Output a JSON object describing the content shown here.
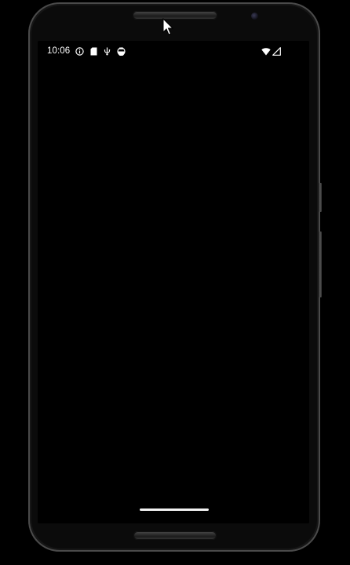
{
  "status_bar": {
    "time": "10:06",
    "left_icons": [
      "info-circle-icon",
      "sd-card-icon",
      "usb-debug-icon",
      "media-icon"
    ],
    "right_icons": [
      "wifi-icon",
      "cell-signal-icon"
    ]
  },
  "screen": {
    "background_color": "#000000",
    "content": ""
  },
  "navigation": {
    "type": "gesture",
    "handle_color": "#f2f2f2"
  },
  "device": {
    "frame_color": "#1c1c1c"
  }
}
